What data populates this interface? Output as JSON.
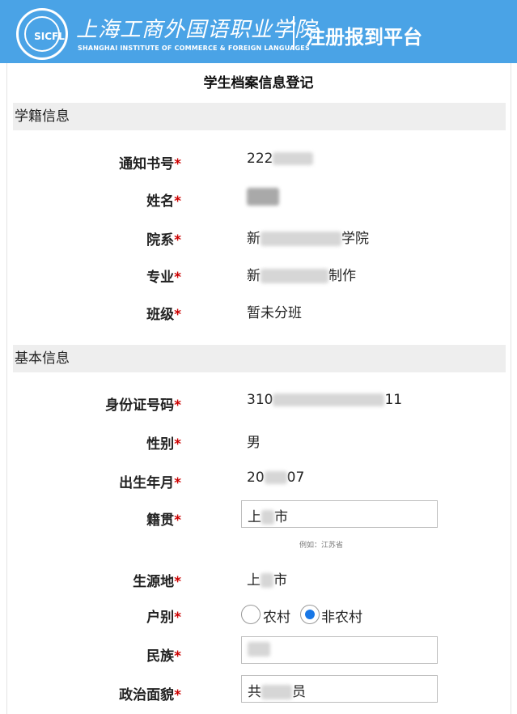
{
  "header": {
    "logo_text": "SICFL",
    "school_name_cn": "上海工商外国语职业学院",
    "school_name_en": "SHANGHAI INSTITUTE OF COMMERCE & FOREIGN LANGUAGES",
    "platform_title": "注册报到平台"
  },
  "page_title": "学生档案信息登记",
  "sections": {
    "school_roll": "学籍信息",
    "basic": "基本信息"
  },
  "required_mark": "*",
  "fields": {
    "notice_no": {
      "label": "通知书号",
      "value_prefix": "222"
    },
    "name": {
      "label": "姓名"
    },
    "department": {
      "label": "院系",
      "value_prefix": "新",
      "value_suffix": "学院"
    },
    "major": {
      "label": "专业",
      "value_prefix": "新",
      "value_suffix": "制作"
    },
    "class": {
      "label": "班级",
      "value": "暂未分班"
    },
    "id_number": {
      "label": "身份证号码",
      "value_prefix": "310",
      "value_suffix": "11"
    },
    "gender": {
      "label": "性别",
      "value": "男"
    },
    "birth": {
      "label": "出生年月",
      "value_prefix": "20",
      "value_suffix": "07"
    },
    "native_place": {
      "label": "籍贯",
      "value_prefix": "上",
      "value_suffix": "市",
      "hint": "例如：江苏省"
    },
    "origin": {
      "label": "生源地",
      "value_prefix": "上",
      "value_suffix": "市"
    },
    "hukou": {
      "label": "户别",
      "options": [
        "农村",
        "非农村"
      ],
      "selected": "非农村"
    },
    "ethnicity": {
      "label": "民族"
    },
    "political": {
      "label": "政治面貌",
      "value_prefix": "共",
      "value_suffix": "员"
    }
  },
  "colors": {
    "header_bg": "#4aa3e6",
    "required": "#cc0000",
    "radio_selected": "#1877e6",
    "section_bg": "#eeeeee"
  }
}
